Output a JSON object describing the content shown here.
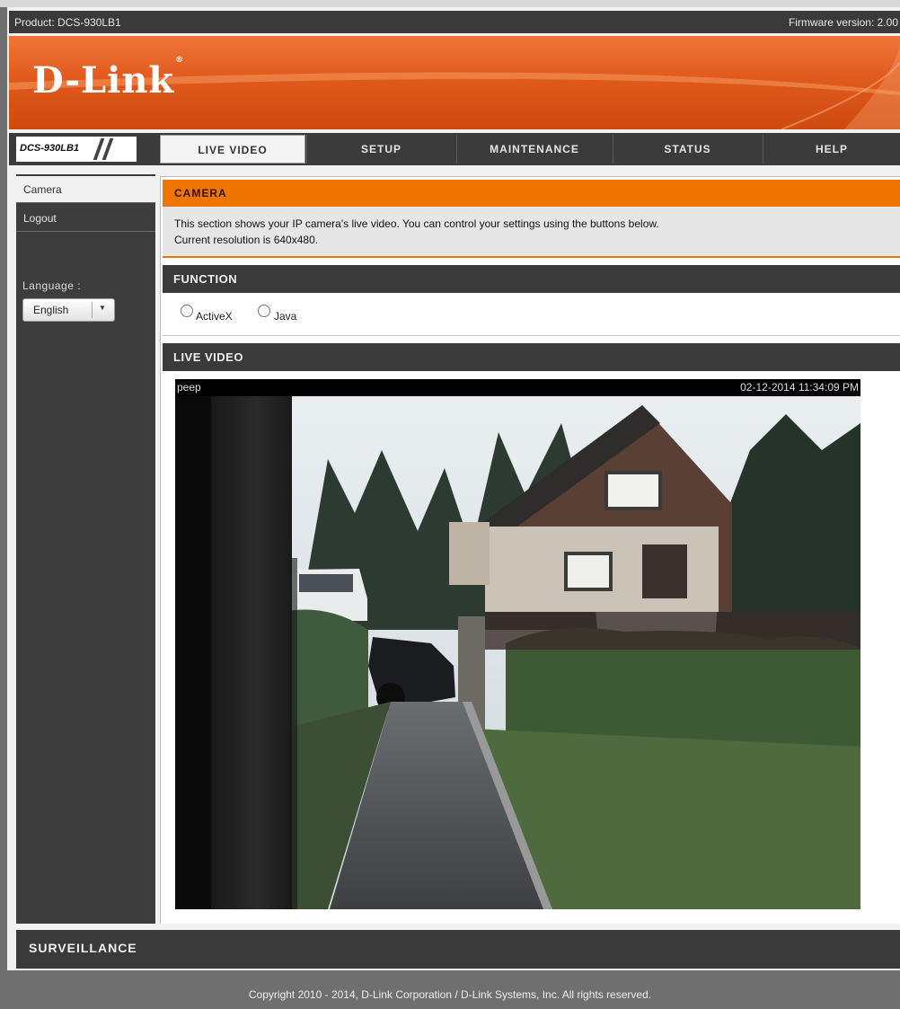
{
  "topbar": {
    "product": "Product: DCS-930LB1",
    "firmware": "Firmware version: 2.00"
  },
  "brand": {
    "logo": "D-Link",
    "registered": "®",
    "model": "DCS-930LB1"
  },
  "nav": {
    "tabs": [
      {
        "label": "LIVE VIDEO",
        "active": true
      },
      {
        "label": "SETUP",
        "active": false
      },
      {
        "label": "MAINTENANCE",
        "active": false
      },
      {
        "label": "STATUS",
        "active": false
      },
      {
        "label": "HELP",
        "active": false
      }
    ]
  },
  "sidebar": {
    "items": [
      {
        "label": "Camera",
        "selected": true
      },
      {
        "label": "Logout",
        "selected": false
      }
    ],
    "language_label": "Language :",
    "language_value": "English",
    "language_arrow": "▼"
  },
  "camera_section": {
    "title": "CAMERA",
    "desc_line1": "This section shows your IP camera's live video. You can control your settings using the buttons below.",
    "desc_line2": "Current resolution is 640x480."
  },
  "function_section": {
    "title": "FUNCTION",
    "options": [
      "ActiveX",
      "Java"
    ],
    "selected": ""
  },
  "live_section": {
    "title": "LIVE VIDEO",
    "caption": "peep",
    "timestamp": "02-12-2014 11:34:09 PM"
  },
  "footer": {
    "surveillance": "SURVEILLANCE",
    "copyright": "Copyright 2010 - 2014, D-Link Corporation / D-Link Systems, Inc. All rights reserved."
  },
  "colors": {
    "accent_orange": "#f07400",
    "dark_bar": "#3a3a3a",
    "banner": "#e05a1c"
  }
}
